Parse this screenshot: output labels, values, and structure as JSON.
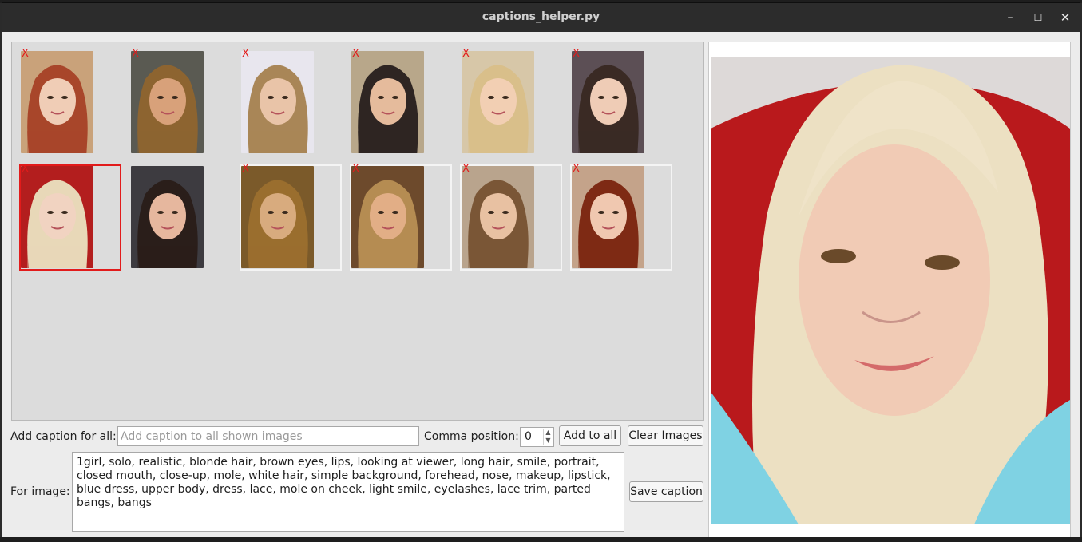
{
  "window": {
    "title": "captions_helper.py",
    "min_glyph": "–",
    "max_glyph": "☐",
    "close_glyph": "✕"
  },
  "colors": {
    "selection": "#e21b1b",
    "remove_mark": "#e21b1b",
    "titlebar": "#2c2c2c"
  },
  "thumbnails": [
    {
      "remove": "X",
      "hair": "#a8462a",
      "bg": "#c9a27a",
      "skin": "#f0cdb6",
      "framed": false,
      "selected": false
    },
    {
      "remove": "X",
      "hair": "#8d6430",
      "bg": "#5a5a52",
      "skin": "#d8a17a",
      "framed": false,
      "selected": false
    },
    {
      "remove": "X",
      "hair": "#a98657",
      "bg": "#e8e6ee",
      "skin": "#e9c4a8",
      "framed": false,
      "selected": false
    },
    {
      "remove": "X",
      "hair": "#2e2522",
      "bg": "#b8a78a",
      "skin": "#e5bb9c",
      "framed": false,
      "selected": false
    },
    {
      "remove": "X",
      "hair": "#d9bf8a",
      "bg": "#d7c7a8",
      "skin": "#f2cfb3",
      "framed": false,
      "selected": false
    },
    {
      "remove": "X",
      "hair": "#3a2a24",
      "bg": "#5c4f55",
      "skin": "#efccb6",
      "framed": false,
      "selected": false
    },
    {
      "remove": "X",
      "hair": "#e8d8b8",
      "bg": "#b31e1e",
      "skin": "#f1d3c1",
      "framed": false,
      "selected": true
    },
    {
      "remove": "",
      "hair": "#2a1e1a",
      "bg": "#3d3b40",
      "skin": "#e6b79e",
      "framed": false,
      "selected": false
    },
    {
      "remove": "X",
      "hair": "#9a6e2e",
      "bg": "#7b5a2a",
      "skin": "#d8ab7e",
      "framed": true,
      "selected": false
    },
    {
      "remove": "X",
      "hair": "#b58c52",
      "bg": "#6d4a2c",
      "skin": "#e2ae86",
      "framed": true,
      "selected": false
    },
    {
      "remove": "X",
      "hair": "#7a5636",
      "bg": "#b9a48d",
      "skin": "#e8c1a2",
      "framed": true,
      "selected": false
    },
    {
      "remove": "X",
      "hair": "#7e2a14",
      "bg": "#c4a38a",
      "skin": "#f0c8b0",
      "framed": true,
      "selected": false
    }
  ],
  "controls": {
    "caption_all_label": "Add caption for all:",
    "caption_all_placeholder": "Add caption to all shown images",
    "comma_label": "Comma position:",
    "comma_value": "0",
    "add_all_button": "Add to all",
    "clear_button": "Clear Images",
    "for_image_label": "For image:",
    "image_caption": "1girl, solo, realistic, blonde hair, brown eyes, lips, looking at viewer, long hair, smile, portrait, closed mouth, close-up, mole, white hair, simple background, forehead, nose, makeup, lipstick, blue dress, upper body, dress, lace, mole on cheek, light smile, eyelashes, lace trim, parted bangs, bangs",
    "save_button": "Save caption"
  }
}
